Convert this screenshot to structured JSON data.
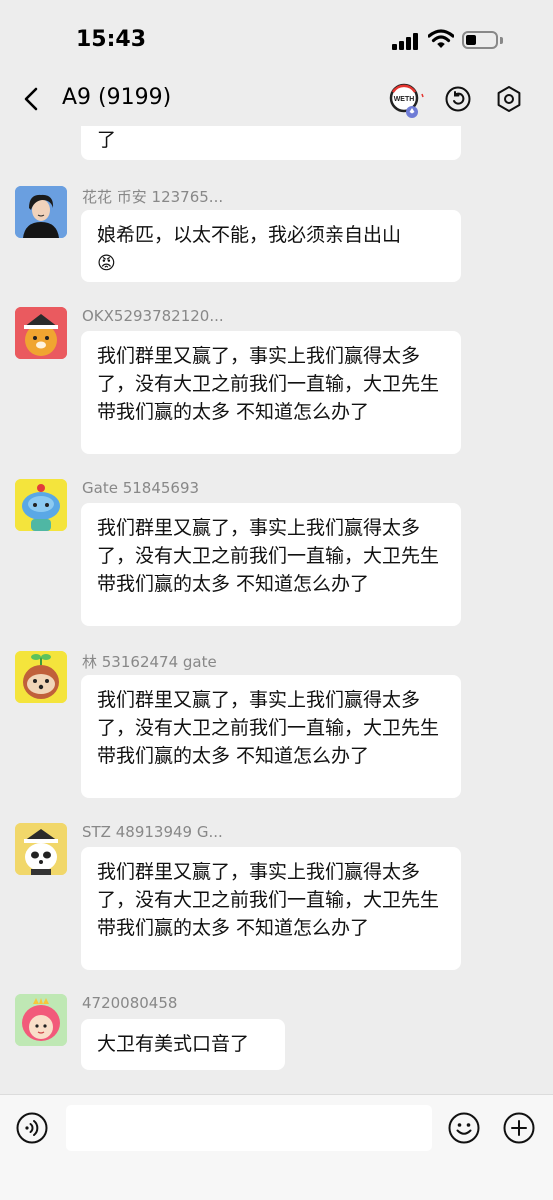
{
  "status": {
    "time": "15:43",
    "battery_level": 0.35
  },
  "header": {
    "title": "A9 (9199)",
    "weth_badge": "WETH"
  },
  "icons": {
    "back": "chevron-left-icon",
    "weth": "weth-token-icon",
    "refresh": "refresh-icon",
    "settings": "settings-icon",
    "voice": "voice-icon",
    "emoji": "emoji-icon",
    "add": "plus-icon"
  },
  "messages": [
    {
      "text": "了"
    },
    {
      "sender": "花花 币安 123765...",
      "text": "娘希匹，以太不能，我必须亲自出山",
      "emoji": "😡"
    },
    {
      "sender": "OKX5293782120...",
      "text": "我们群里又赢了，事实上我们赢得太多了，没有大卫之前我们一直输，大卫先生带我们赢的太多 不知道怎么办了"
    },
    {
      "sender": "Gate 51845693",
      "text": "我们群里又赢了，事实上我们赢得太多了，没有大卫之前我们一直输，大卫先生带我们赢的太多 不知道怎么办了"
    },
    {
      "sender": "林 53162474 gate",
      "text": "我们群里又赢了，事实上我们赢得太多了，没有大卫之前我们一直输，大卫先生带我们赢的太多 不知道怎么办了"
    },
    {
      "sender": "STZ 48913949 G...",
      "text": "我们群里又赢了，事实上我们赢得太多了，没有大卫之前我们一直输，大卫先生带我们赢的太多 不知道怎么办了"
    },
    {
      "sender": "4720080458",
      "text": "大卫有美式口音了"
    }
  ],
  "input": {
    "placeholder": ""
  },
  "colors": {
    "background": "#ededed",
    "bubble": "#ffffff",
    "sender": "#888888",
    "input_bar": "#f7f7f7"
  }
}
